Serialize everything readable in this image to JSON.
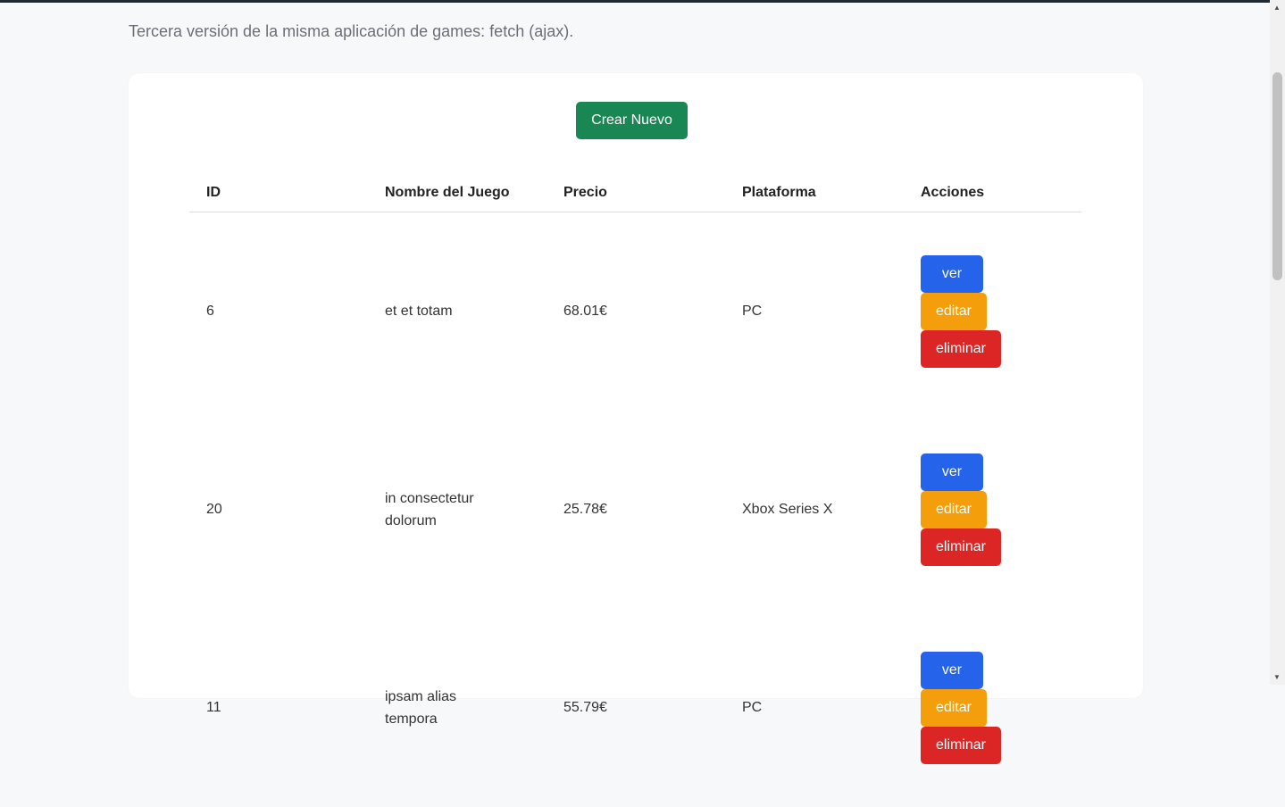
{
  "page": {
    "subtitle": "Tercera versión de la misma aplicación de games: fetch (ajax)."
  },
  "toolbar": {
    "create_label": "Crear Nuevo"
  },
  "table": {
    "headers": {
      "id": "ID",
      "name": "Nombre del Juego",
      "price": "Precio",
      "platform": "Plataforma",
      "actions": "Acciones"
    },
    "rows": [
      {
        "id": "6",
        "name": "et et totam",
        "price": "68.01€",
        "platform": "PC",
        "view_label": "ver",
        "edit_label": "editar",
        "delete_label": "eliminar"
      },
      {
        "id": "20",
        "name": "in consectetur dolorum",
        "price": "25.78€",
        "platform": "Xbox Series X",
        "view_label": "ver",
        "edit_label": "editar",
        "delete_label": "eliminar"
      },
      {
        "id": "11",
        "name": "ipsam alias tempora",
        "price": "55.79€",
        "platform": "PC",
        "view_label": "ver",
        "edit_label": "editar",
        "delete_label": "eliminar"
      }
    ]
  },
  "colors": {
    "create": "#198754",
    "view": "#2563eb",
    "edit": "#f59e0b",
    "delete": "#dc2626"
  },
  "scrollbar": {
    "up_icon": "▲",
    "down_icon": "▼"
  }
}
